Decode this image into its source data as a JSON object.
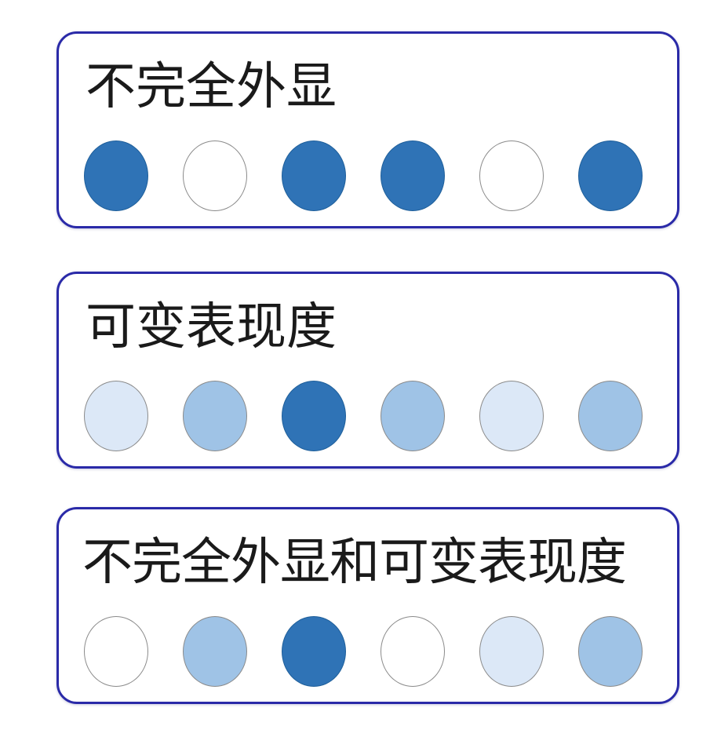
{
  "panels": [
    {
      "title": "不完全外显",
      "dots": [
        {
          "shade": "dark",
          "color": "#2f73b6"
        },
        {
          "shade": "none",
          "color": "#ffffff"
        },
        {
          "shade": "dark",
          "color": "#2f73b6"
        },
        {
          "shade": "dark",
          "color": "#2f73b6"
        },
        {
          "shade": "none",
          "color": "#ffffff"
        },
        {
          "shade": "dark",
          "color": "#2f73b6"
        }
      ]
    },
    {
      "title": "可变表现度",
      "dots": [
        {
          "shade": "light",
          "color": "#dce8f7"
        },
        {
          "shade": "medium",
          "color": "#9fc3e6"
        },
        {
          "shade": "dark",
          "color": "#2f73b6"
        },
        {
          "shade": "medium",
          "color": "#9fc3e6"
        },
        {
          "shade": "light",
          "color": "#dce8f7"
        },
        {
          "shade": "medium",
          "color": "#9fc3e6"
        }
      ]
    },
    {
      "title": "不完全外显和可变表现度",
      "dots": [
        {
          "shade": "none",
          "color": "#ffffff"
        },
        {
          "shade": "medium",
          "color": "#9fc3e6"
        },
        {
          "shade": "dark",
          "color": "#2f73b6"
        },
        {
          "shade": "none",
          "color": "#ffffff"
        },
        {
          "shade": "light",
          "color": "#dce8f7"
        },
        {
          "shade": "medium",
          "color": "#9fc3e6"
        }
      ]
    }
  ]
}
